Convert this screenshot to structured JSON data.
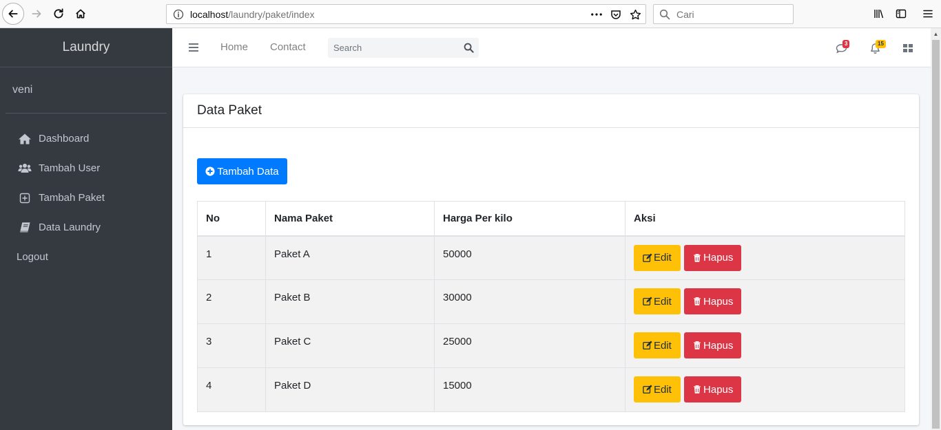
{
  "browser": {
    "url_host": "localhost",
    "url_path": "/laundry/paket/index",
    "search_placeholder": "Cari"
  },
  "sidebar": {
    "brand": "Laundry",
    "user": "veni",
    "items": [
      {
        "label": "Dashboard",
        "icon": "home-icon"
      },
      {
        "label": "Tambah User",
        "icon": "users-icon"
      },
      {
        "label": "Tambah Paket",
        "icon": "plus-square-icon"
      },
      {
        "label": "Data Laundry",
        "icon": "book-icon"
      }
    ],
    "logout": "Logout"
  },
  "navbar": {
    "links": [
      "Home",
      "Contact"
    ],
    "search_placeholder": "Search",
    "messages_count": "3",
    "notifications_count": "15"
  },
  "colors": {
    "sidebar_bg": "#343a40",
    "primary": "#007bff",
    "warning": "#ffc107",
    "danger": "#dc3545"
  },
  "card": {
    "title": "Data Paket",
    "add_button": "Tambah Data",
    "table": {
      "headers": [
        "No",
        "Nama Paket",
        "Harga Per kilo",
        "Aksi"
      ],
      "rows": [
        {
          "no": "1",
          "nama": "Paket A",
          "harga": "50000"
        },
        {
          "no": "2",
          "nama": "Paket B",
          "harga": "30000"
        },
        {
          "no": "3",
          "nama": "Paket C",
          "harga": "25000"
        },
        {
          "no": "4",
          "nama": "Paket D",
          "harga": "15000"
        }
      ],
      "edit_label": "Edit",
      "delete_label": "Hapus"
    }
  }
}
